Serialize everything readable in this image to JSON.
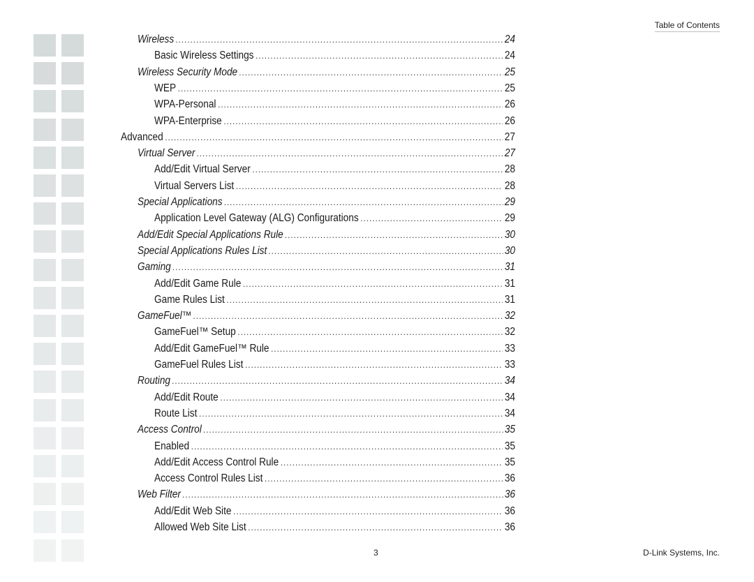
{
  "header": {
    "title": "Table of Contents"
  },
  "toc": [
    {
      "level": 2,
      "label": "Wireless",
      "page": "24"
    },
    {
      "level": 3,
      "label": "Basic Wireless Settings",
      "page": "24"
    },
    {
      "level": 2,
      "label": "Wireless Security Mode",
      "page": "25"
    },
    {
      "level": 3,
      "label": "WEP",
      "page": "25"
    },
    {
      "level": 3,
      "label": "WPA-Personal",
      "page": "26"
    },
    {
      "level": 3,
      "label": "WPA-Enterprise",
      "page": "26"
    },
    {
      "level": 1,
      "label": "Advanced",
      "page": "27"
    },
    {
      "level": 2,
      "label": "Virtual Server",
      "page": "27"
    },
    {
      "level": 3,
      "label": "Add/Edit Virtual Server",
      "page": "28"
    },
    {
      "level": 3,
      "label": "Virtual Servers List",
      "page": "28"
    },
    {
      "level": 2,
      "label": "Special Applications",
      "page": "29"
    },
    {
      "level": 3,
      "label": "Application Level Gateway (ALG) Configurations",
      "page": "29"
    },
    {
      "level": 2,
      "label": "Add/Edit Special Applications Rule",
      "page": "30"
    },
    {
      "level": 2,
      "label": "Special Applications Rules List",
      "page": "30"
    },
    {
      "level": 2,
      "label": "Gaming",
      "page": "31"
    },
    {
      "level": 3,
      "label": "Add/Edit Game Rule",
      "page": "31"
    },
    {
      "level": 3,
      "label": "Game Rules List",
      "page": "31"
    },
    {
      "level": 2,
      "label": "GameFuel™",
      "page": "32"
    },
    {
      "level": 3,
      "label": "GameFuel™ Setup",
      "page": "32"
    },
    {
      "level": 3,
      "label": "Add/Edit GameFuel™ Rule",
      "page": "33"
    },
    {
      "level": 3,
      "label": "GameFuel Rules List",
      "page": "33"
    },
    {
      "level": 2,
      "label": "Routing",
      "page": "34"
    },
    {
      "level": 3,
      "label": "Add/Edit Route",
      "page": "34"
    },
    {
      "level": 3,
      "label": "Route List",
      "page": "34"
    },
    {
      "level": 2,
      "label": "Access Control",
      "page": "35"
    },
    {
      "level": 3,
      "label": "Enabled",
      "page": "35"
    },
    {
      "level": 3,
      "label": "Add/Edit Access Control Rule",
      "page": "35"
    },
    {
      "level": 3,
      "label": "Access Control Rules List",
      "page": "36"
    },
    {
      "level": 2,
      "label": "Web Filter",
      "page": "36"
    },
    {
      "level": 3,
      "label": "Add/Edit Web Site",
      "page": "36"
    },
    {
      "level": 3,
      "label": "Allowed Web Site List",
      "page": "36"
    }
  ],
  "footer": {
    "page_number": "3",
    "company": "D-Link Systems, Inc."
  },
  "colors": {
    "grid_top": "#d5dadb",
    "grid_bottom": "#f1f3f3",
    "text": "#1a1a1a"
  }
}
